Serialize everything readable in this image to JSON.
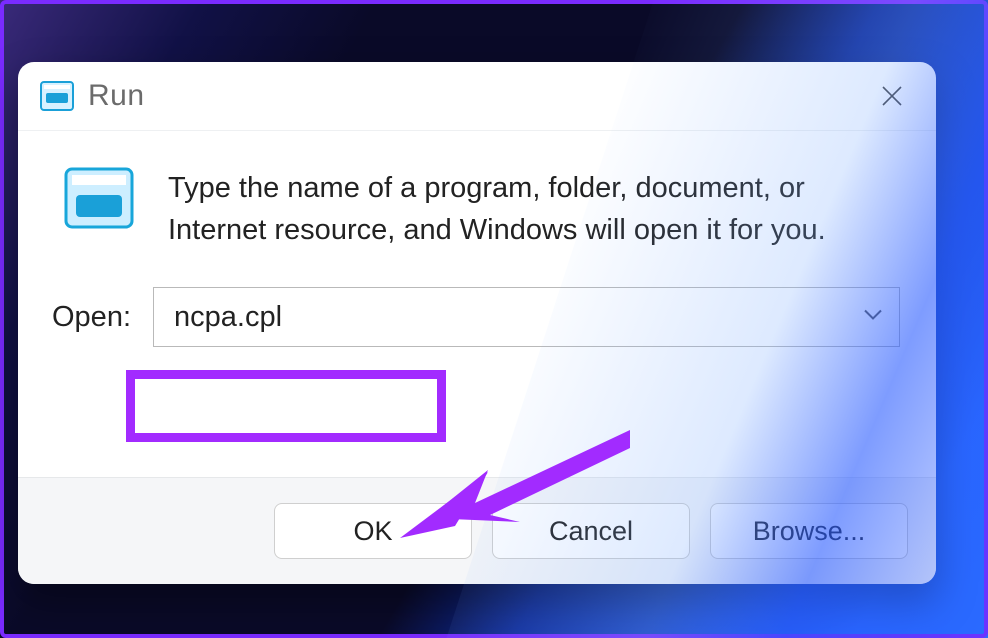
{
  "dialog": {
    "title": "Run",
    "description": "Type the name of a program, folder, document, or Internet resource, and Windows will open it for you.",
    "open_label": "Open:",
    "open_value": "ncpa.cpl",
    "buttons": {
      "ok": "OK",
      "cancel": "Cancel",
      "browse": "Browse..."
    }
  },
  "annotation": {
    "highlight_color": "#a22bff",
    "arrow_color": "#a22bff"
  }
}
